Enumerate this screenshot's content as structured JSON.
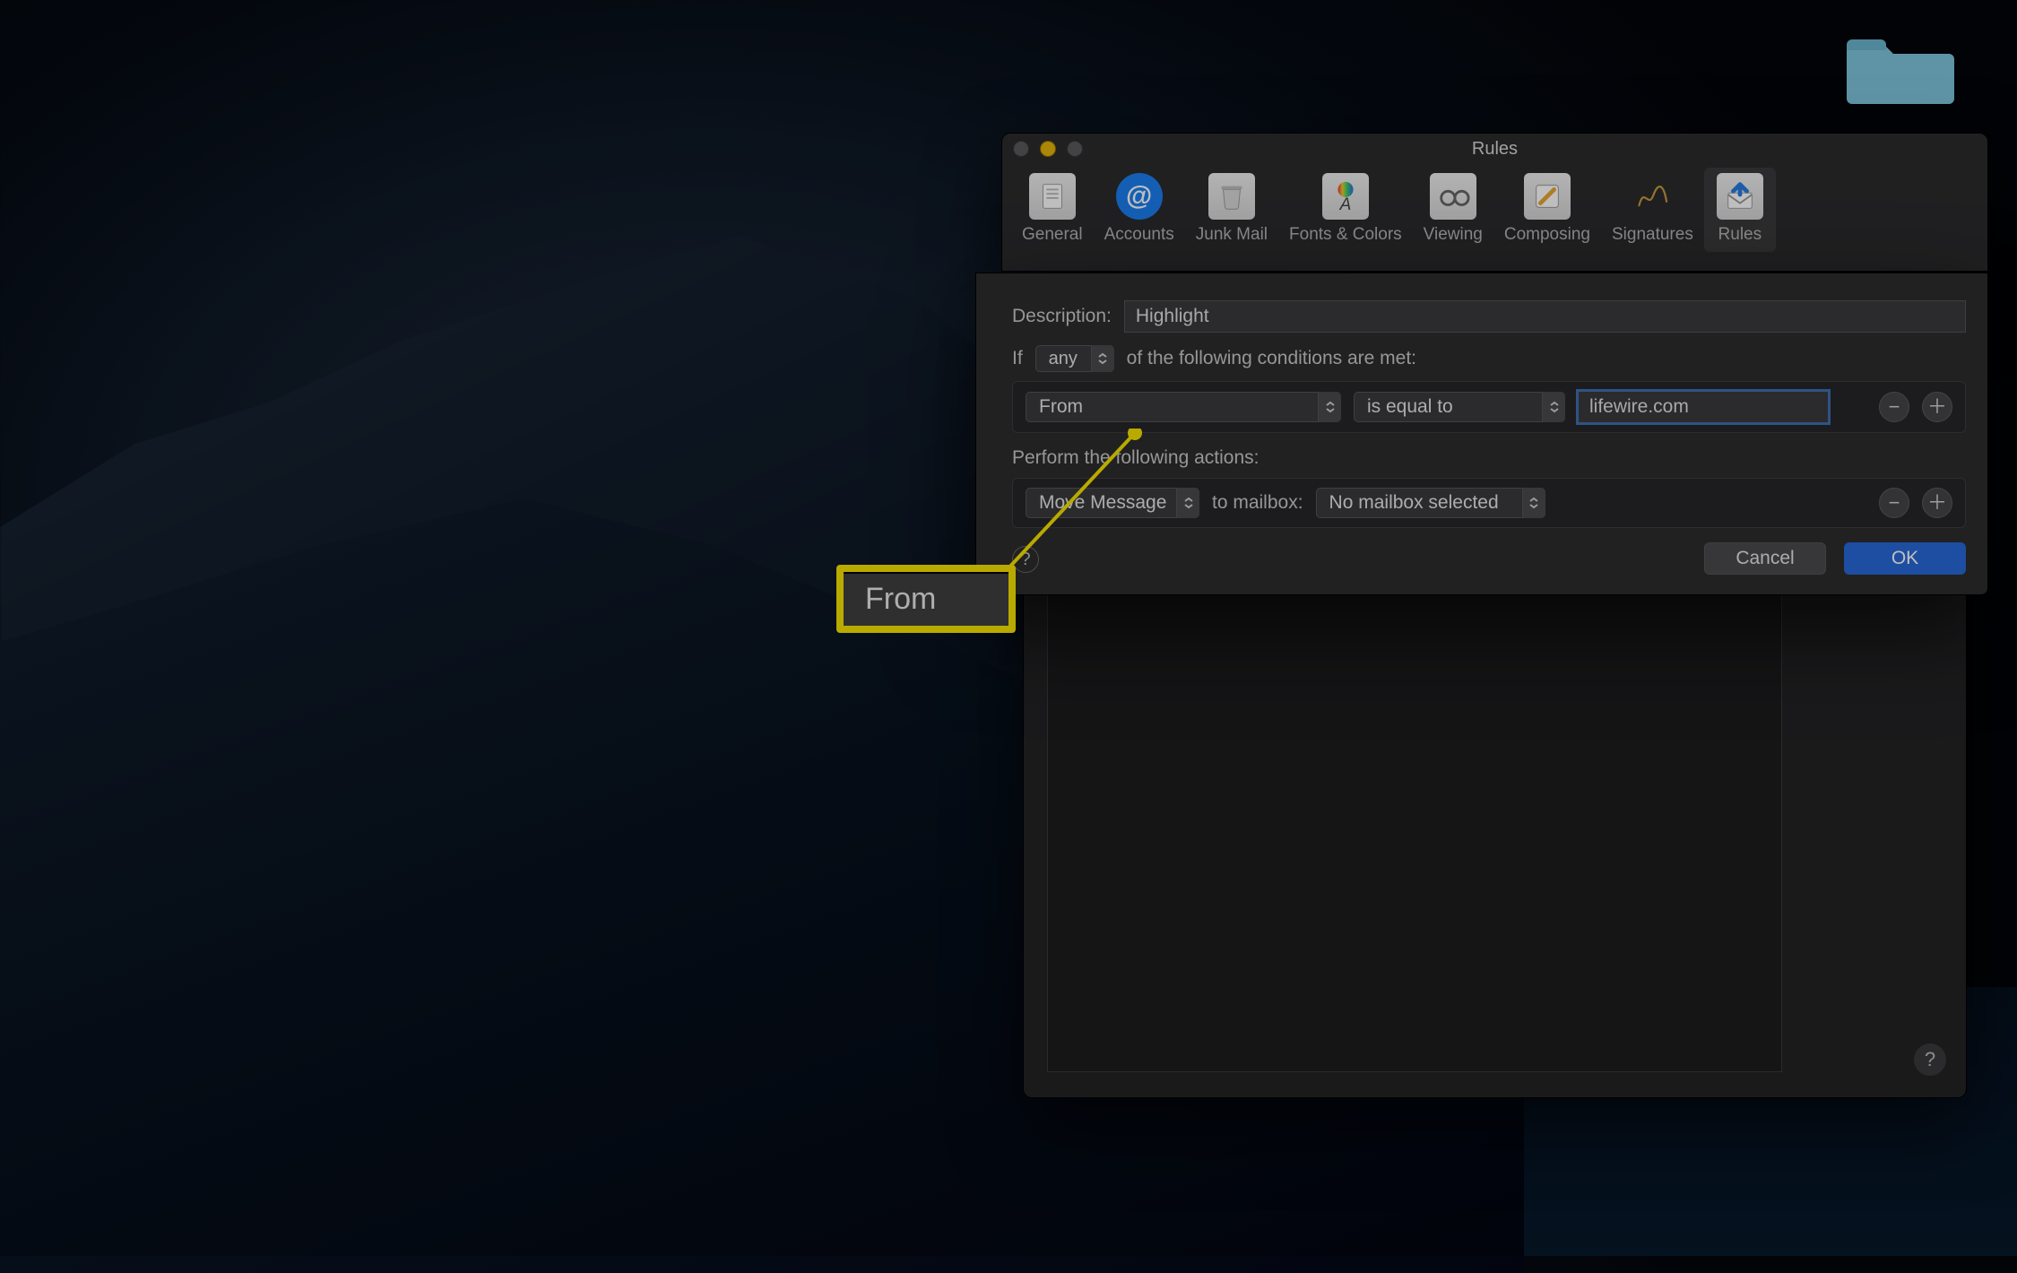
{
  "desktop": {
    "folder_name": "Folder"
  },
  "preferences_window": {
    "title": "Rules",
    "tabs": {
      "general": "General",
      "accounts": "Accounts",
      "junk": "Junk Mail",
      "fonts": "Fonts & Colors",
      "viewing": "Viewing",
      "composing": "Composing",
      "signatures": "Signatures",
      "rules": "Rules"
    },
    "active_tab": "rules"
  },
  "rule_sheet": {
    "description_label": "Description:",
    "description_value": "Highlight",
    "if_label": "If",
    "any_label": "any",
    "conditions_tail": "of the following conditions are met:",
    "condition": {
      "field": "From",
      "operator": "is equal to",
      "value": "lifewire.com"
    },
    "actions_label": "Perform the following actions:",
    "action": {
      "type": "Move Message",
      "to_mailbox_label": "to mailbox:",
      "mailbox": "No mailbox selected"
    },
    "buttons": {
      "cancel": "Cancel",
      "ok": "OK",
      "help": "?"
    }
  },
  "annotation": {
    "callout_text": "From"
  }
}
